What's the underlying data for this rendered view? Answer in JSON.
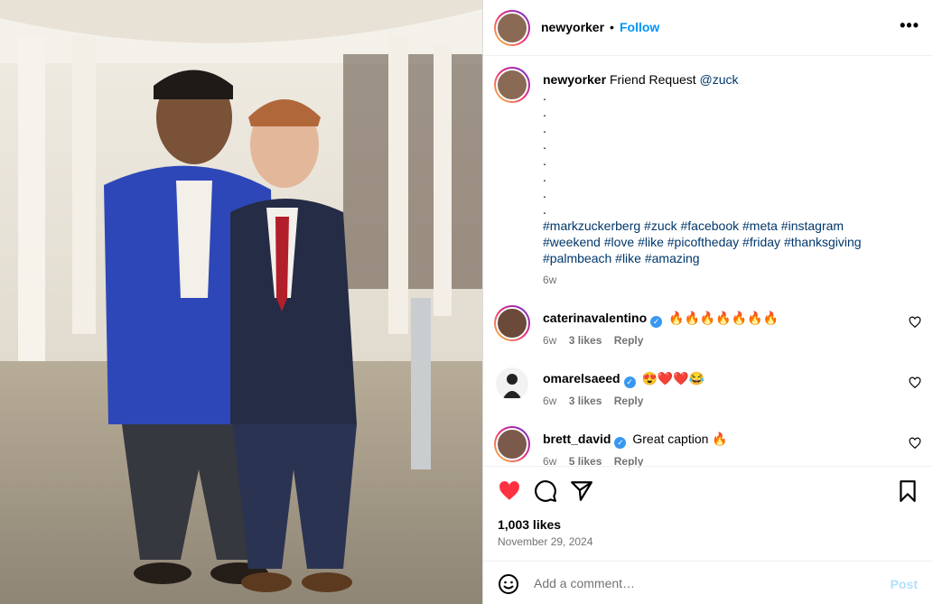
{
  "post": {
    "username": "newyorker",
    "separator": "•",
    "follow_label": "Follow",
    "more_icon": "more-horizontal-icon"
  },
  "caption": {
    "username": "newyorker",
    "text": "Friend Request",
    "mention": "@zuck",
    "dots": [
      ".",
      ".",
      ".",
      ".",
      ".",
      ".",
      ".",
      "."
    ],
    "hashtags_line1": "#markzuckerberg #zuck #facebook #meta #instagram",
    "hashtags_line2": "#weekend #love #like #picoftheday #friday #thanksgiving",
    "hashtags_line3": "#palmbeach #like #amazing",
    "time": "6w"
  },
  "comments": [
    {
      "username": "caterinavalentino",
      "verified": "✓",
      "text": "🔥🔥🔥🔥🔥🔥🔥",
      "time": "6w",
      "likes": "3 likes",
      "reply": "Reply"
    },
    {
      "username": "omarelsaeed",
      "verified": "✓",
      "text": "😍❤️❤️😂",
      "time": "6w",
      "likes": "3 likes",
      "reply": "Reply"
    },
    {
      "username": "brett_david",
      "verified": "✓",
      "text": "Great caption 🔥",
      "time": "6w",
      "likes": "5 likes",
      "reply": "Reply"
    }
  ],
  "actions": {
    "likes": "1,003 likes",
    "date": "November 29, 2024",
    "liked": true,
    "like_color": "#ff3040"
  },
  "compose": {
    "placeholder": "Add a comment…",
    "post_label": "Post"
  },
  "colors": {
    "link": "#0095f6",
    "hashtag": "#00376b",
    "muted": "#737373"
  }
}
